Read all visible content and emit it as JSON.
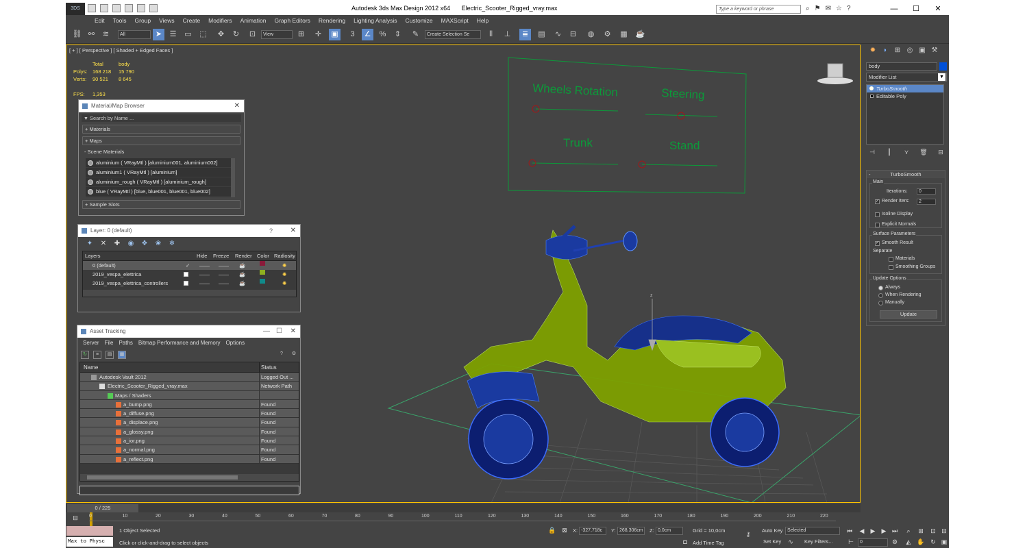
{
  "titlebar": {
    "app_title": "Autodesk 3ds Max Design 2012 x64",
    "file_name": "Electric_Scooter_Rigged_vray.max",
    "logo": "3DS",
    "search_placeholder": "Type a keyword or phrase",
    "minimize": "—",
    "maximize": "☐",
    "close": "✕"
  },
  "menu": [
    "Edit",
    "Tools",
    "Group",
    "Views",
    "Create",
    "Modifiers",
    "Animation",
    "Graph Editors",
    "Rendering",
    "Lighting Analysis",
    "Customize",
    "MAXScript",
    "Help"
  ],
  "toolbar": {
    "filter_select": "All",
    "refcoord_select": "View",
    "named_selection": "Create Selection Se"
  },
  "viewport": {
    "label": "[ + ] [ Perspective ] [ Shaded + Edged Faces ]",
    "stats": {
      "header_total": "Total",
      "header_obj": "body",
      "polys_label": "Polys:",
      "polys_total": "168 218",
      "polys_obj": "15 790",
      "verts_label": "Verts:",
      "verts_total": "90 521",
      "verts_obj": "8 645",
      "fps_label": "FPS:",
      "fps_value": "1,353"
    },
    "controls_panel": {
      "labels": [
        "Wheels Rotation",
        "Steering",
        "Trunk",
        "Stand"
      ]
    },
    "axis_label": "z"
  },
  "material_browser": {
    "title": "Material/Map Browser",
    "search": "Search by Name ...",
    "sections": [
      "+ Materials",
      "+ Maps",
      "- Scene Materials",
      "+ Sample Slots"
    ],
    "items": [
      "aluminium  ( VRayMtl )  [aluminium001, aluminium002]",
      "aluminium1  ( VRayMtl )  [aluminium]",
      "aluminium_rough  ( VRayMtl )  [aluminium_rough]",
      "blue  ( VRayMtl )  [blue, blue001, blue001, blue002]"
    ]
  },
  "layer_manager": {
    "title": "Layer: 0 (default)",
    "help": "?",
    "columns": [
      "Layers",
      "Hide",
      "Freeze",
      "Render",
      "Color",
      "Radiosity"
    ],
    "rows": [
      {
        "name": "0 (default)",
        "color": "#8a1a3a",
        "current": "✓"
      },
      {
        "name": "2019_vespa_elettrica",
        "color": "#8fb020",
        "current": ""
      },
      {
        "name": "2019_vespa_elettrica_controllers",
        "color": "#108a8a",
        "current": ""
      }
    ],
    "dash": "——"
  },
  "asset_tracking": {
    "title": "Asset Tracking",
    "menu": [
      "Server",
      "File",
      "Paths",
      "Bitmap Performance and Memory",
      "Options"
    ],
    "columns": [
      "Name",
      "Status"
    ],
    "rows": [
      {
        "name": "Autodesk Vault 2012",
        "status": "Logged Out ...",
        "indent": 1
      },
      {
        "name": "Electric_Scooter_Rigged_vray.max",
        "status": "Network Path",
        "indent": 2
      },
      {
        "name": "Maps / Shaders",
        "status": "",
        "indent": 3
      },
      {
        "name": "a_bump.png",
        "status": "Found",
        "indent": 4
      },
      {
        "name": "a_diffuse.png",
        "status": "Found",
        "indent": 4
      },
      {
        "name": "a_displace.png",
        "status": "Found",
        "indent": 4
      },
      {
        "name": "a_glossy.png",
        "status": "Found",
        "indent": 4
      },
      {
        "name": "a_ior.png",
        "status": "Found",
        "indent": 4
      },
      {
        "name": "a_normal.png",
        "status": "Found",
        "indent": 4
      },
      {
        "name": "a_reflect.png",
        "status": "Found",
        "indent": 4
      }
    ]
  },
  "command_panel": {
    "object_name": "body",
    "object_color": "#0050d8",
    "modifier_list": "Modifier List",
    "stack": [
      "TurboSmooth",
      "Editable Poly"
    ],
    "turbosmooth": {
      "title": "TurboSmooth",
      "main": "Main",
      "iterations_label": "Iterations:",
      "iterations": "0",
      "render_iters_label": "Render Iters:",
      "render_iters": "2",
      "isoline": "Isoline Display",
      "explicit_normals": "Explicit Normals",
      "surface_params": "Surface Parameters",
      "smooth_result": "Smooth Result",
      "separate": "Separate",
      "materials": "Materials",
      "smoothing_groups": "Smoothing Groups",
      "update_options": "Update Options",
      "always": "Always",
      "when_rendering": "When Rendering",
      "manually": "Manually",
      "update_btn": "Update"
    }
  },
  "timeline": {
    "frame": "0 / 225",
    "ticks": [
      "0",
      "10",
      "20",
      "30",
      "40",
      "50",
      "60",
      "70",
      "80",
      "90",
      "100",
      "110",
      "120",
      "130",
      "140",
      "150",
      "160",
      "170",
      "180",
      "190",
      "200",
      "210",
      "220"
    ]
  },
  "status": {
    "selected": "1 Object Selected",
    "prompt": "Click or click-and-drag to select objects",
    "maxscript": "Max to Physc",
    "x_label": "X:",
    "x": "-327,718c",
    "y_label": "Y:",
    "y": "268,306cm",
    "z_label": "Z:",
    "z": "0,0cm",
    "grid": "Grid = 10,0cm",
    "add_time_tag": "Add Time Tag",
    "auto_key": "Auto Key",
    "set_key": "Set Key",
    "key_mode": "Selected",
    "key_filters": "Key Filters...",
    "frame_field": "0"
  }
}
